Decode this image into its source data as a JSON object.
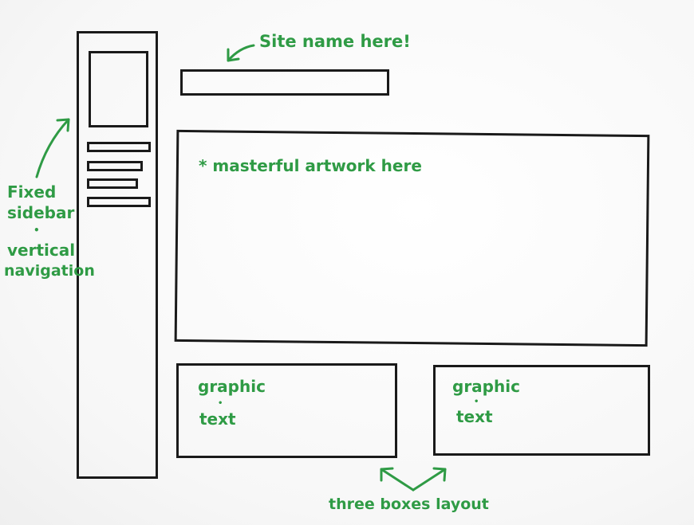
{
  "annotations": {
    "site_name": "Site name here!",
    "artwork": "* masterful artwork here",
    "sidebar_line1": "Fixed",
    "sidebar_line2": "sidebar",
    "sidebar_bullet": "•",
    "sidebar_line3": "vertical",
    "sidebar_line4": "navigation",
    "box1_graphic": "graphic",
    "box1_dot": "•",
    "box1_text": "text",
    "box2_graphic": "graphic",
    "box2_dot": "•",
    "box2_text": "text",
    "three_boxes": "three boxes layout"
  },
  "colors": {
    "ink": "#1a1a1a",
    "annotation": "#2f9b45"
  }
}
